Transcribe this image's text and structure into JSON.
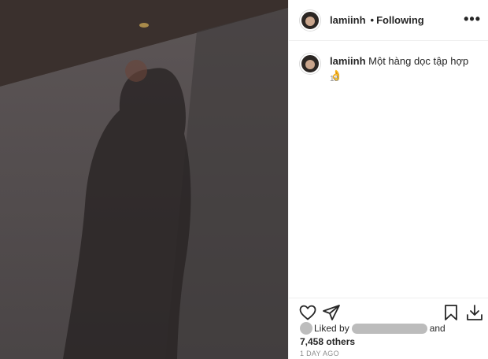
{
  "post": {
    "photo_description_icon": "shadow-photo",
    "username": "lamiinh",
    "bullet": "•",
    "follow_status": "Following",
    "more_icon": "more-horizontal-icon",
    "more_glyph": "•••"
  },
  "caption": {
    "username": "lamiinh",
    "text": "Một hàng dọc tập hợp 👌",
    "time": "1d"
  },
  "actions": {
    "like_icon": "heart-icon",
    "share_icon": "send-icon",
    "save_icon": "bookmark-icon",
    "download_icon": "download-icon"
  },
  "likes": {
    "prefix": "Liked by",
    "suffix": "and",
    "others": "7,458 others"
  },
  "timestamp": "1 DAY AGO",
  "colors": {
    "text": "#262626",
    "muted": "#8e8e8e",
    "divider": "#efefef"
  }
}
